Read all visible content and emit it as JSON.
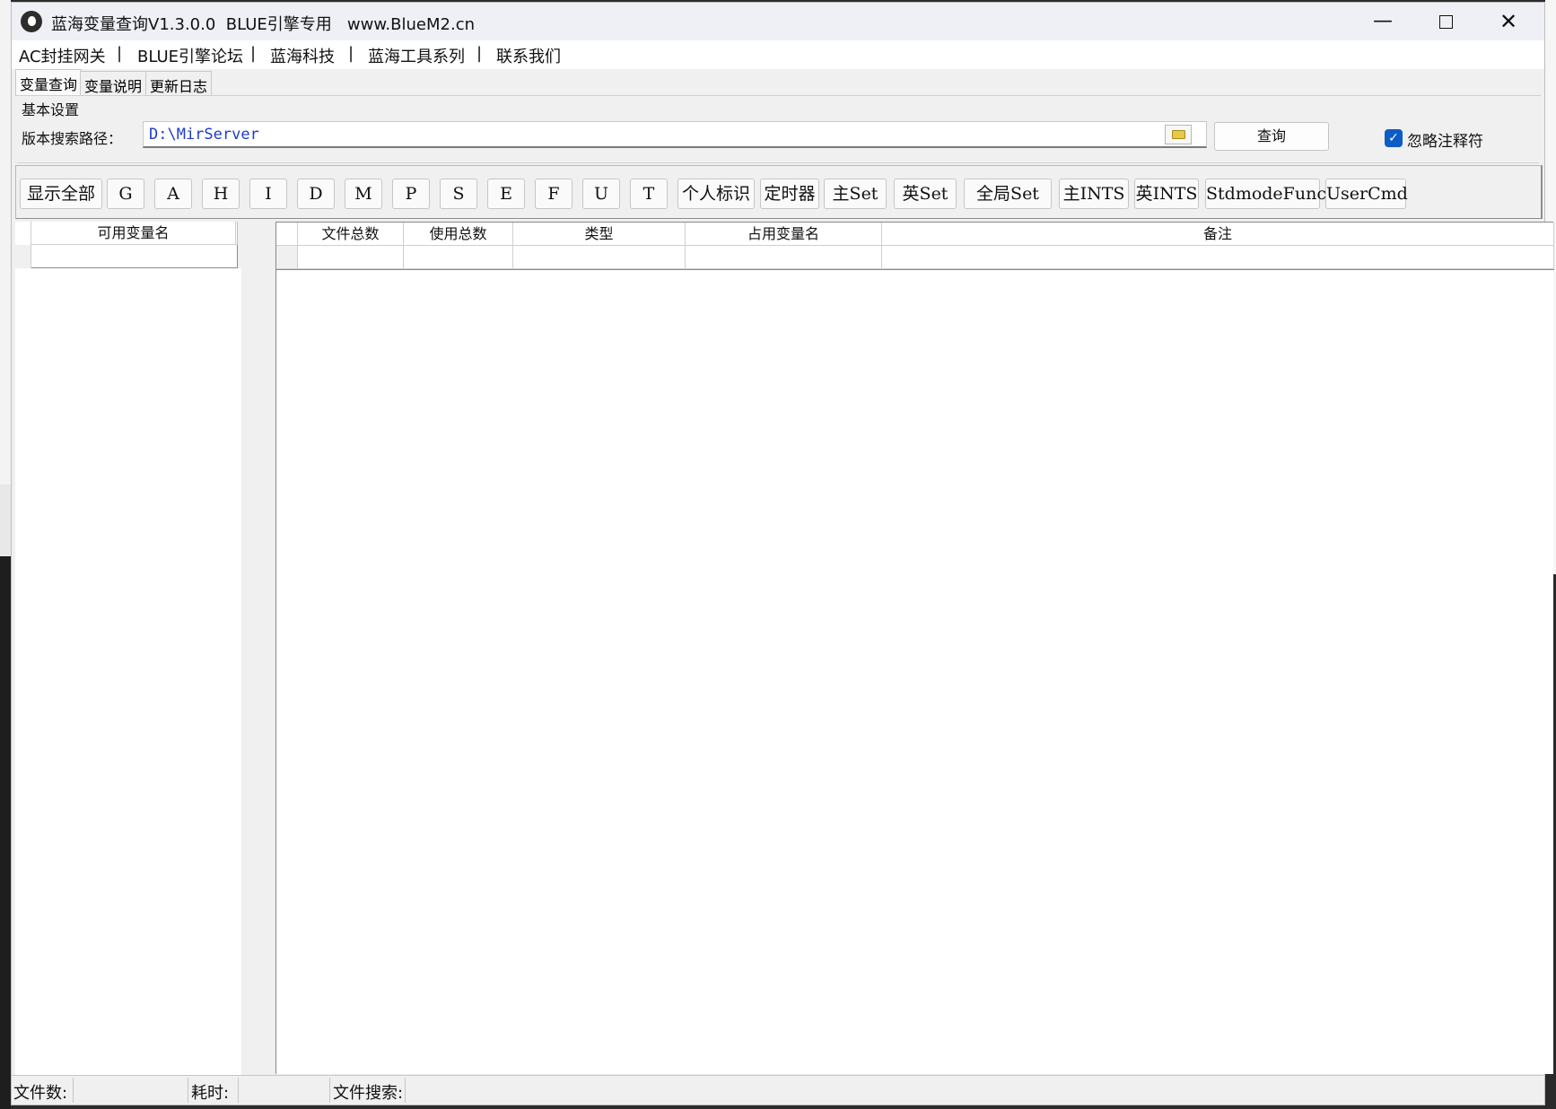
{
  "window": {
    "title": "蓝海变量查询V1.3.0.0  BLUE引擎专用   www.BlueM2.cn",
    "min_glyph": "—",
    "close_glyph": "✕"
  },
  "menu": {
    "items": [
      "AC封挂网关",
      "BLUE引擎论坛",
      "蓝海科技",
      "蓝海工具系列",
      "联系我们"
    ],
    "separator": "|"
  },
  "tabs": [
    "变量查询",
    "变量说明",
    "更新日志"
  ],
  "settings": {
    "group_title": "基本设置",
    "path_label": "版本搜索路径：",
    "path_value": "D:\\MirServer",
    "query_button": "查询",
    "ignore_comments_label": "忽略注释符",
    "ignore_comments_checked": true
  },
  "filters": [
    "显示全部",
    "G",
    "A",
    "H",
    "I",
    "D",
    "M",
    "P",
    "S",
    "E",
    "F",
    "U",
    "T",
    "个人标识",
    "定时器",
    "主Set",
    "英Set",
    "全局Set",
    "主INTS",
    "英INTS",
    "StdmodeFunc",
    "UserCmd"
  ],
  "left_grid": {
    "columns": [
      "可用变量名"
    ]
  },
  "right_grid": {
    "columns": [
      "文件总数",
      "使用总数",
      "类型",
      "占用变量名",
      "备注"
    ]
  },
  "status": {
    "file_count_label": "文件数:",
    "elapsed_label": "耗时:",
    "file_search_label": "文件搜索:"
  }
}
